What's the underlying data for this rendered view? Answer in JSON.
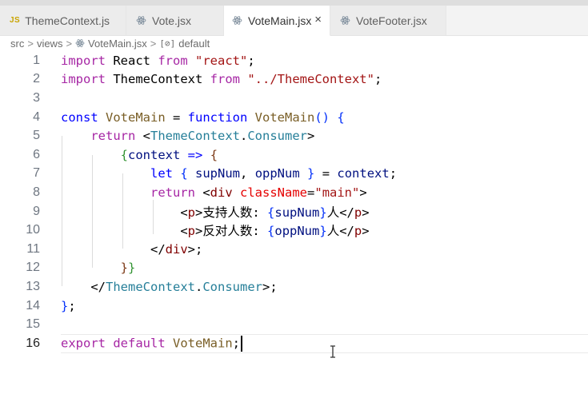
{
  "tabs": [
    {
      "label": "ThemeContext.js",
      "icon": "js-badge",
      "badge": "JS",
      "active": false
    },
    {
      "label": "Vote.jsx",
      "icon": "react-icon",
      "active": false
    },
    {
      "label": "VoteMain.jsx",
      "icon": "react-icon",
      "active": true,
      "close": "×"
    },
    {
      "label": "VoteFooter.jsx",
      "icon": "react-icon",
      "active": false
    }
  ],
  "breadcrumb": {
    "items": [
      "src",
      "views",
      "VoteMain.jsx",
      "default"
    ],
    "separator": ">",
    "symbol_icon": "[⊘]"
  },
  "editor": {
    "current_line": 16,
    "lines": [
      {
        "n": "1",
        "tokens": [
          [
            "kw",
            "import"
          ],
          [
            "plain",
            " React "
          ],
          [
            "kw",
            "from"
          ],
          [
            "plain",
            " "
          ],
          [
            "str",
            "\"react\""
          ],
          [
            "plain",
            ";"
          ]
        ]
      },
      {
        "n": "2",
        "tokens": [
          [
            "kw",
            "import"
          ],
          [
            "plain",
            " ThemeContext "
          ],
          [
            "kw",
            "from"
          ],
          [
            "plain",
            " "
          ],
          [
            "str",
            "\"../ThemeContext\""
          ],
          [
            "plain",
            ";"
          ]
        ]
      },
      {
        "n": "3",
        "tokens": []
      },
      {
        "n": "4",
        "tokens": [
          [
            "kw2",
            "const"
          ],
          [
            "plain",
            " "
          ],
          [
            "fn",
            "VoteMain"
          ],
          [
            "plain",
            " = "
          ],
          [
            "kw2",
            "function"
          ],
          [
            "plain",
            " "
          ],
          [
            "fn",
            "VoteMain"
          ],
          [
            "br1",
            "()"
          ],
          [
            "plain",
            " "
          ],
          [
            "br1",
            "{"
          ]
        ]
      },
      {
        "n": "5",
        "tokens": [
          [
            "plain",
            "    "
          ],
          [
            "kw",
            "return"
          ],
          [
            "plain",
            " "
          ],
          [
            "plain",
            "<"
          ],
          [
            "type",
            "ThemeContext"
          ],
          [
            "plain",
            "."
          ],
          [
            "type",
            "Consumer"
          ],
          [
            "plain",
            ">"
          ]
        ]
      },
      {
        "n": "6",
        "tokens": [
          [
            "plain",
            "        "
          ],
          [
            "br2",
            "{"
          ],
          [
            "var",
            "context"
          ],
          [
            "plain",
            " "
          ],
          [
            "kw2",
            "=>"
          ],
          [
            "plain",
            " "
          ],
          [
            "br3",
            "{"
          ]
        ]
      },
      {
        "n": "7",
        "tokens": [
          [
            "plain",
            "            "
          ],
          [
            "kw2",
            "let"
          ],
          [
            "plain",
            " "
          ],
          [
            "br1",
            "{"
          ],
          [
            "plain",
            " "
          ],
          [
            "var",
            "supNum"
          ],
          [
            "plain",
            ", "
          ],
          [
            "var",
            "oppNum"
          ],
          [
            "plain",
            " "
          ],
          [
            "br1",
            "}"
          ],
          [
            "plain",
            " = "
          ],
          [
            "var",
            "context"
          ],
          [
            "plain",
            ";"
          ]
        ]
      },
      {
        "n": "8",
        "tokens": [
          [
            "plain",
            "            "
          ],
          [
            "kw",
            "return"
          ],
          [
            "plain",
            " "
          ],
          [
            "plain",
            "<"
          ],
          [
            "tag",
            "div"
          ],
          [
            "plain",
            " "
          ],
          [
            "attr",
            "className"
          ],
          [
            "plain",
            "="
          ],
          [
            "str",
            "\"main\""
          ],
          [
            "plain",
            ">"
          ]
        ]
      },
      {
        "n": "9",
        "tokens": [
          [
            "plain",
            "                "
          ],
          [
            "plain",
            "<"
          ],
          [
            "tag",
            "p"
          ],
          [
            "plain",
            ">"
          ],
          [
            "plain",
            "支持人数: "
          ],
          [
            "br1",
            "{"
          ],
          [
            "var",
            "supNum"
          ],
          [
            "br1",
            "}"
          ],
          [
            "plain",
            "人"
          ],
          [
            "plain",
            "</"
          ],
          [
            "tag",
            "p"
          ],
          [
            "plain",
            ">"
          ]
        ]
      },
      {
        "n": "10",
        "tokens": [
          [
            "plain",
            "                "
          ],
          [
            "plain",
            "<"
          ],
          [
            "tag",
            "p"
          ],
          [
            "plain",
            ">"
          ],
          [
            "plain",
            "反对人数: "
          ],
          [
            "br1",
            "{"
          ],
          [
            "var",
            "oppNum"
          ],
          [
            "br1",
            "}"
          ],
          [
            "plain",
            "人"
          ],
          [
            "plain",
            "</"
          ],
          [
            "tag",
            "p"
          ],
          [
            "plain",
            ">"
          ]
        ]
      },
      {
        "n": "11",
        "tokens": [
          [
            "plain",
            "            "
          ],
          [
            "plain",
            "</"
          ],
          [
            "tag",
            "div"
          ],
          [
            "plain",
            ">;"
          ]
        ]
      },
      {
        "n": "12",
        "tokens": [
          [
            "plain",
            "        "
          ],
          [
            "br3",
            "}"
          ],
          [
            "br2",
            "}"
          ]
        ]
      },
      {
        "n": "13",
        "tokens": [
          [
            "plain",
            "    "
          ],
          [
            "plain",
            "</"
          ],
          [
            "type",
            "ThemeContext"
          ],
          [
            "plain",
            "."
          ],
          [
            "type",
            "Consumer"
          ],
          [
            "plain",
            ">;"
          ]
        ]
      },
      {
        "n": "14",
        "tokens": [
          [
            "br1",
            "}"
          ],
          [
            "plain",
            ";"
          ]
        ]
      },
      {
        "n": "15",
        "tokens": []
      },
      {
        "n": "16",
        "tokens": [
          [
            "kw",
            "export"
          ],
          [
            "plain",
            " "
          ],
          [
            "kw",
            "default"
          ],
          [
            "plain",
            " "
          ],
          [
            "fn",
            "VoteMain"
          ],
          [
            "plain",
            ";"
          ]
        ]
      }
    ]
  },
  "colors": {
    "keyword_import": "#a626a4",
    "keyword_decl": "#0000ff",
    "string": "#a31515",
    "function": "#795e26",
    "tag": "#800000",
    "component": "#267f99",
    "attribute": "#e50000",
    "variable": "#001080"
  }
}
